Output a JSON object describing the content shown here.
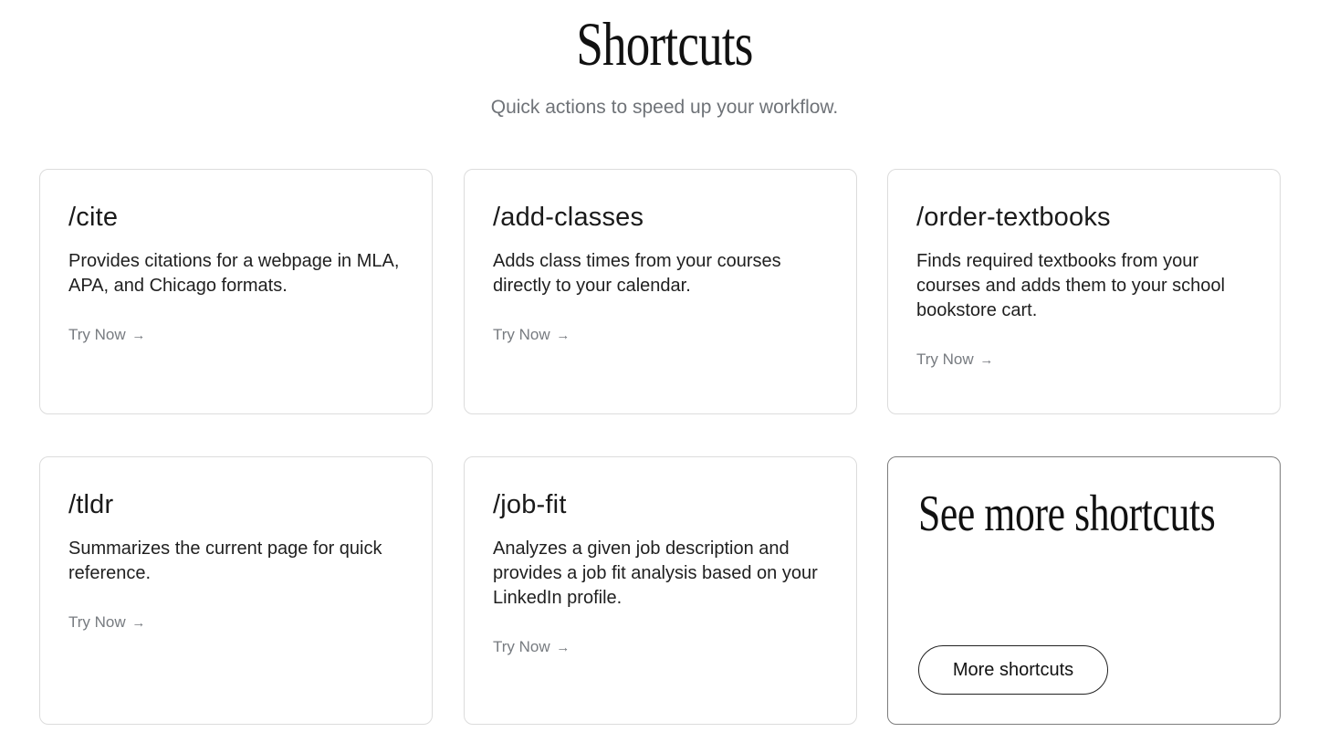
{
  "header": {
    "title": "Shortcuts",
    "subtitle": "Quick actions to speed up your workflow."
  },
  "cards": [
    {
      "title": "/cite",
      "description": "Provides citations for a webpage in MLA, APA, and Chicago formats.",
      "link_label": "Try Now",
      "link_arrow": "→"
    },
    {
      "title": "/add-classes",
      "description": "Adds class times from your courses directly to your calendar.",
      "link_label": "Try Now",
      "link_arrow": "→"
    },
    {
      "title": "/order-textbooks",
      "description": "Finds required textbooks from your courses and adds them to your school bookstore cart.",
      "link_label": "Try Now",
      "link_arrow": "→"
    },
    {
      "title": "/tldr",
      "description": "Summarizes the current page for quick reference.",
      "link_label": "Try Now",
      "link_arrow": "→"
    },
    {
      "title": "/job-fit",
      "description": "Analyzes a given job description and provides a job fit analysis based on your LinkedIn profile.",
      "link_label": "Try Now",
      "link_arrow": "→"
    }
  ],
  "more": {
    "title": "See more shortcuts",
    "button_label": "More shortcuts"
  }
}
